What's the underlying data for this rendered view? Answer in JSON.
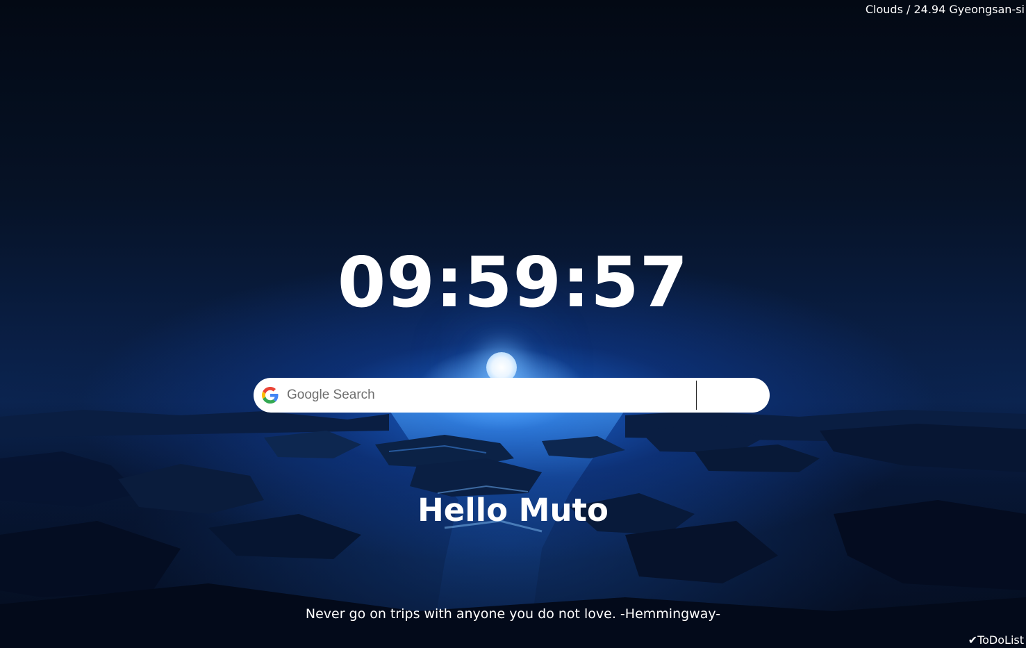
{
  "weather": {
    "text": "Clouds / 24.94 Gyeongsan-si"
  },
  "clock": {
    "time": "09:59:57"
  },
  "search": {
    "placeholder": "Google Search",
    "value": "",
    "icon": "google-g-icon"
  },
  "greeting": {
    "text": "Hello Muto"
  },
  "quote": {
    "text": "Never go on trips with anyone you do not love. -Hemmingway-"
  },
  "todo": {
    "label": "✔ToDoList"
  },
  "colors": {
    "google_blue": "#4285F4",
    "google_red": "#EA4335",
    "google_yellow": "#FBBC05",
    "google_green": "#34A853"
  }
}
